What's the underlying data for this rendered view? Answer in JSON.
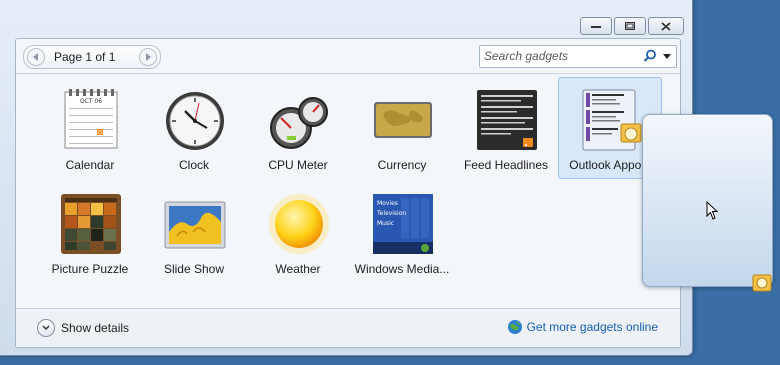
{
  "toolbar": {
    "page_label": "Page 1 of 1",
    "search_placeholder": "Search gadgets"
  },
  "gadgets": [
    {
      "label": "Calendar",
      "icon": "calendar-icon",
      "calendar_month": "OCT 06",
      "calendar_today": "25"
    },
    {
      "label": "Clock",
      "icon": "clock-icon"
    },
    {
      "label": "CPU Meter",
      "icon": "cpu-meter-icon"
    },
    {
      "label": "Currency",
      "icon": "currency-icon"
    },
    {
      "label": "Feed Headlines",
      "icon": "feed-headlines-icon"
    },
    {
      "label": "Outlook Appoin",
      "icon": "outlook-appointments-icon",
      "selected": true
    },
    {
      "label": "Picture Puzzle",
      "icon": "picture-puzzle-icon"
    },
    {
      "label": "Slide Show",
      "icon": "slide-show-icon"
    },
    {
      "label": "Weather",
      "icon": "weather-icon"
    },
    {
      "label": "Windows Media...",
      "icon": "windows-media-center-icon",
      "menu_items": [
        "Movies",
        "Television",
        "Music"
      ]
    }
  ],
  "footer": {
    "show_details_label": "Show details",
    "get_more_label": "Get more gadgets online"
  },
  "colors": {
    "desktop_background": "#3a6ea5",
    "link": "#1460b5",
    "selection": "#d9e8f8"
  }
}
